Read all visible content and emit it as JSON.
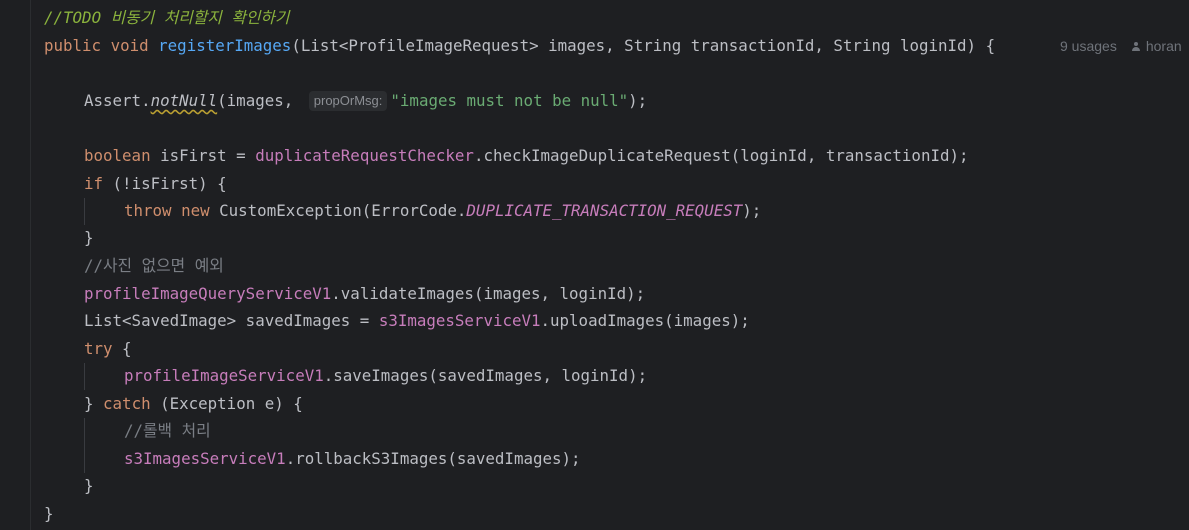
{
  "editor": {
    "todo_comment_slashes": "//",
    "todo_comment_text": "TODO 비동기 처리할지 확인하기",
    "sig": {
      "kw_public": "public",
      "kw_void": "void",
      "method": "registerImages",
      "params": "(List<ProfileImageRequest> images, String transactionId, String loginId) {"
    },
    "inlay_hints": {
      "usages": "9 usages",
      "author": "horan"
    },
    "assert_line": {
      "prefix": "Assert.",
      "method": "notNull",
      "open": "(images, ",
      "param_hint": "propOrMsg:",
      "string": "\"images must not be null\"",
      "close": ");"
    },
    "boolean_line": {
      "kw": "boolean",
      "decl": " isFirst = ",
      "field": "duplicateRequestChecker",
      "rest": ".checkImageDuplicateRequest(loginId, transactionId);"
    },
    "if_line": {
      "kw": "if",
      "rest": " (!isFirst) {"
    },
    "throw_line": {
      "kw_throw": "throw",
      "kw_new": "new",
      "ctor": " CustomException(ErrorCode.",
      "constant": "DUPLICATE_TRANSACTION_REQUEST",
      "close": ");"
    },
    "close_brace": "}",
    "comment_no_photo": "//사진 없으면 예외",
    "validate_line": {
      "field": "profileImageQueryServiceV1",
      "rest": ".validateImages(images, loginId);"
    },
    "saved_images_line": {
      "decl": "List<SavedImage> savedImages = ",
      "field": "s3ImagesServiceV1",
      "rest": ".uploadImages(images);"
    },
    "try_line": {
      "kw": "try",
      "rest": " {"
    },
    "save_line": {
      "field": "profileImageServiceV1",
      "rest": ".saveImages(savedImages, loginId);"
    },
    "catch_line": {
      "open": "} ",
      "kw": "catch",
      "rest": " (Exception e) {"
    },
    "comment_rollback": "//롤백 처리",
    "rollback_line": {
      "field": "s3ImagesServiceV1",
      "rest": ".rollbackS3Images(savedImages);"
    },
    "colors": {
      "background": "#1e1f22",
      "default_text": "#bcbec4",
      "keyword": "#cf8e6d",
      "method_declaration": "#56a8f5",
      "field": "#c77dbb",
      "string": "#6aab73",
      "comment": "#7a7e85",
      "todo": "#8bb33d",
      "inlay_hint": "#8c8f94"
    }
  }
}
